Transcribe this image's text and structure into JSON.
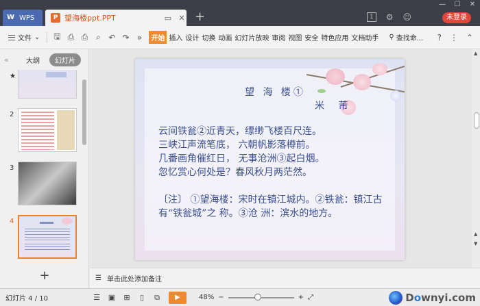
{
  "titlebar": {
    "app_tab": "WPS",
    "doc_tab": "望海楼ppt.PPT",
    "new_tab": "+",
    "page_badge": "1",
    "login": "未登录"
  },
  "ribbon": {
    "menu": "文件",
    "tabs": [
      "开始",
      "插入",
      "设计",
      "切换",
      "动画",
      "幻灯片放映",
      "审阅",
      "视图",
      "安全",
      "特色应用",
      "文档助手"
    ],
    "search": "查找命...",
    "more": "»"
  },
  "left_panel": {
    "tab_outline": "大纲",
    "tab_slides": "幻灯片",
    "slides": [
      {
        "num": "★"
      },
      {
        "num": "2"
      },
      {
        "num": "3"
      },
      {
        "num": "4"
      }
    ],
    "add": "+"
  },
  "slide": {
    "title": "望 海 楼①",
    "author": "米 芾",
    "poem": [
      "云间铁瓮②近青天，缥缈飞楼百尺连。",
      "三峡江声流笔底， 六朝帆影落樽前。",
      "几番画角催红日， 无事沧洲③起白烟。",
      "忽忆赏心何处是？春风秋月两茫然。"
    ],
    "note": "〔注〕 ①望海楼：宋时在镇江城内。②铁瓮：镇江古有“铁瓮城”之 称。③沧 洲：滨水的地方。"
  },
  "notes": {
    "placeholder": "单击此处添加备注"
  },
  "status": {
    "slide_info": "幻灯片 4 / 10",
    "zoom": "48%",
    "zoom_minus": "−",
    "zoom_plus": "+"
  },
  "watermark": {
    "text_a": "D",
    "text_b": "o",
    "text_c": "wnyi.com"
  },
  "colors": {
    "accent": "#f08a2e",
    "login": "#e0463a",
    "slide_text": "#3a4f8f"
  }
}
